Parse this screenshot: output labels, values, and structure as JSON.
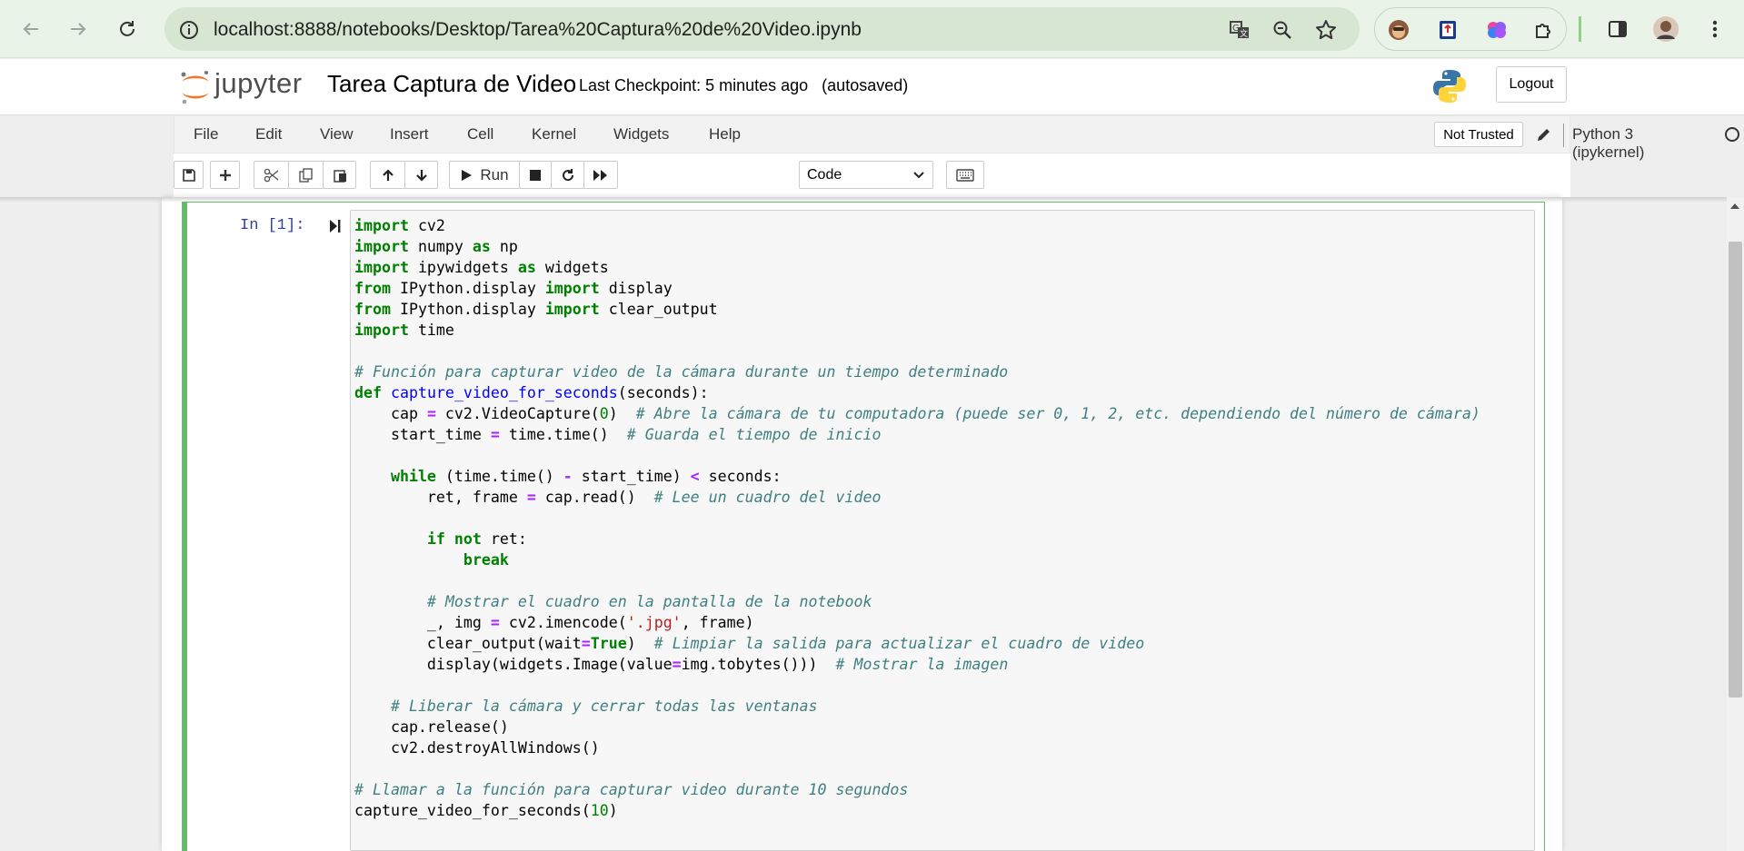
{
  "browser": {
    "url": "localhost:8888/notebooks/Desktop/Tarea%20Captura%20de%20Video.ipynb",
    "icons": [
      "back-arrow-icon",
      "forward-arrow-icon",
      "reload-icon",
      "site-info-icon",
      "translate-icon",
      "zoom-icon",
      "bookmark-star-icon",
      "extension-monkey-icon",
      "extension-upload-icon",
      "extension-brain-icon",
      "extensions-puzzle-icon",
      "side-panel-icon",
      "profile-avatar",
      "browser-menu-icon"
    ]
  },
  "header": {
    "logo_text": "jupyter",
    "notebook_title": "Tarea Captura de Video",
    "checkpoint": "Last Checkpoint: 5 minutes ago",
    "autosave": "(autosaved)",
    "logout": "Logout"
  },
  "menubar": {
    "items": [
      "File",
      "Edit",
      "View",
      "Insert",
      "Cell",
      "Kernel",
      "Widgets",
      "Help"
    ],
    "trust_status": "Not Trusted",
    "kernel": "Python 3 (ipykernel)"
  },
  "toolbar": {
    "run_label": "Run",
    "cell_type": "Code"
  },
  "cell": {
    "prompt": "In [1]:"
  },
  "colors": {
    "browser_bar": "#e9f3e7",
    "cell_border": "#66bb6a",
    "prompt": "#303f9f"
  }
}
